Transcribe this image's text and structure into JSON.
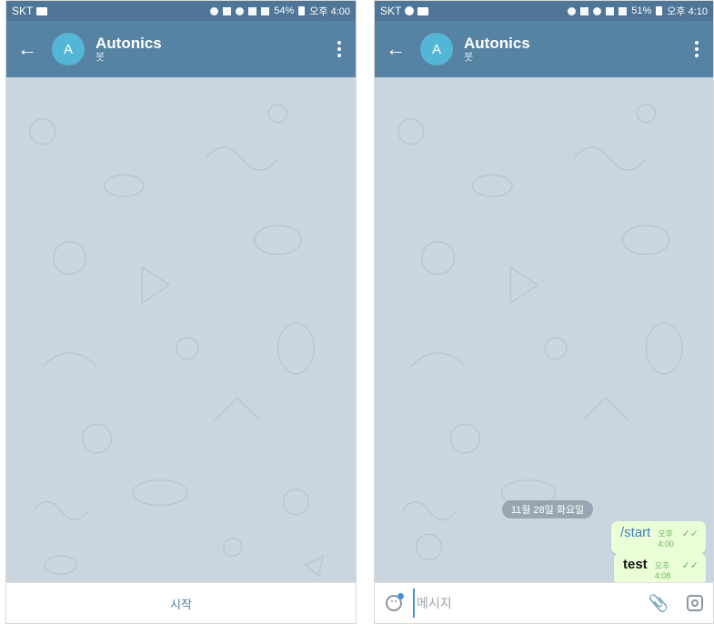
{
  "left_screen": {
    "status": {
      "carrier": "SKT",
      "right": "54%",
      "time": "오후 4:00"
    },
    "header": {
      "back_icon": "arrow-left-icon",
      "avatar_letter": "A",
      "title": "Autonics",
      "subtitle": "봇",
      "menu_icon": "more-vert-icon"
    },
    "bottom": {
      "start_label": "시작"
    }
  },
  "right_screen": {
    "status": {
      "carrier": "SKT",
      "right": "51%",
      "time": "오후 4:10"
    },
    "header": {
      "back_icon": "arrow-left-icon",
      "avatar_letter": "A",
      "title": "Autonics",
      "subtitle": "봇",
      "menu_icon": "more-vert-icon"
    },
    "chat": {
      "date_chip": "11월 28일 화요일",
      "messages": [
        {
          "text": "/start",
          "time": "오후 4:00",
          "status": "read"
        },
        {
          "text": "test",
          "time": "오후 4:08",
          "status": "read"
        }
      ]
    },
    "input": {
      "placeholder": "메시지",
      "attach_icon": "paperclip-icon",
      "camera_icon": "camera-icon",
      "emoji_icon": "emoji-icon"
    }
  },
  "colors": {
    "header": "#5682a3",
    "statusbar": "#4f7696",
    "chat_bg": "#cad6df",
    "outgoing_bubble": "#eaffd8",
    "check": "#6cb35d",
    "link": "#4b7fab"
  }
}
